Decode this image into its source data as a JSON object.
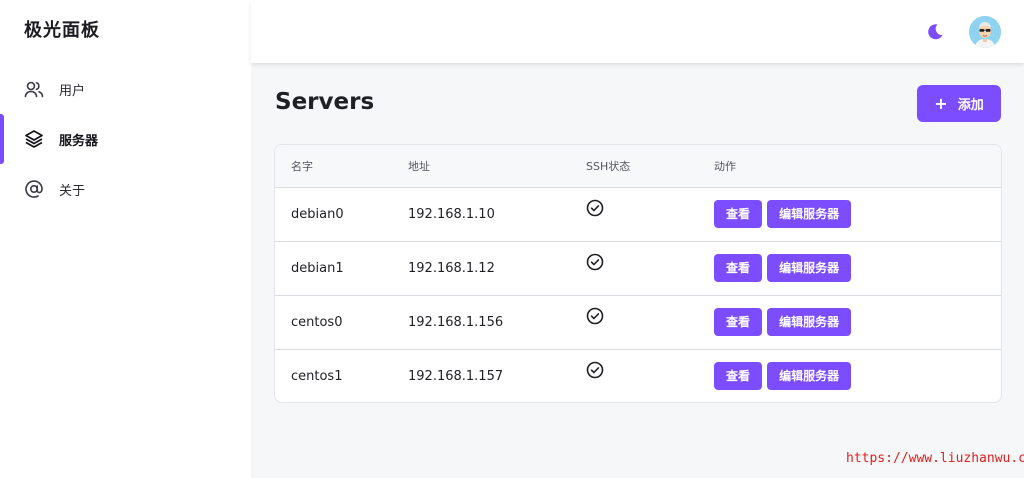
{
  "app": {
    "title": "极光面板"
  },
  "sidebar": {
    "items": [
      {
        "label": "用户",
        "icon": "users-icon",
        "active": false
      },
      {
        "label": "服务器",
        "icon": "layers-icon",
        "active": true
      },
      {
        "label": "关于",
        "icon": "at-sign-icon",
        "active": false
      }
    ]
  },
  "header": {
    "theme_icon": "moon-icon",
    "avatar_icon": "avatar"
  },
  "main": {
    "title": "Servers",
    "add_button": {
      "icon": "+",
      "label": "添加"
    },
    "table": {
      "columns": [
        "名字",
        "地址",
        "SSH状态",
        "动作"
      ],
      "rows": [
        {
          "name": "debian0",
          "address": "192.168.1.10",
          "ssh_ok": true
        },
        {
          "name": "debian1",
          "address": "192.168.1.12",
          "ssh_ok": true
        },
        {
          "name": "centos0",
          "address": "192.168.1.156",
          "ssh_ok": true
        },
        {
          "name": "centos1",
          "address": "192.168.1.157",
          "ssh_ok": true
        }
      ],
      "actions": {
        "view": "查看",
        "edit": "编辑服务器"
      }
    }
  },
  "watermark": "https://www.liuzhanwu.cn",
  "colors": {
    "accent": "#7c4dff",
    "background": "#f6f7f9",
    "watermark": "#e0201d"
  }
}
